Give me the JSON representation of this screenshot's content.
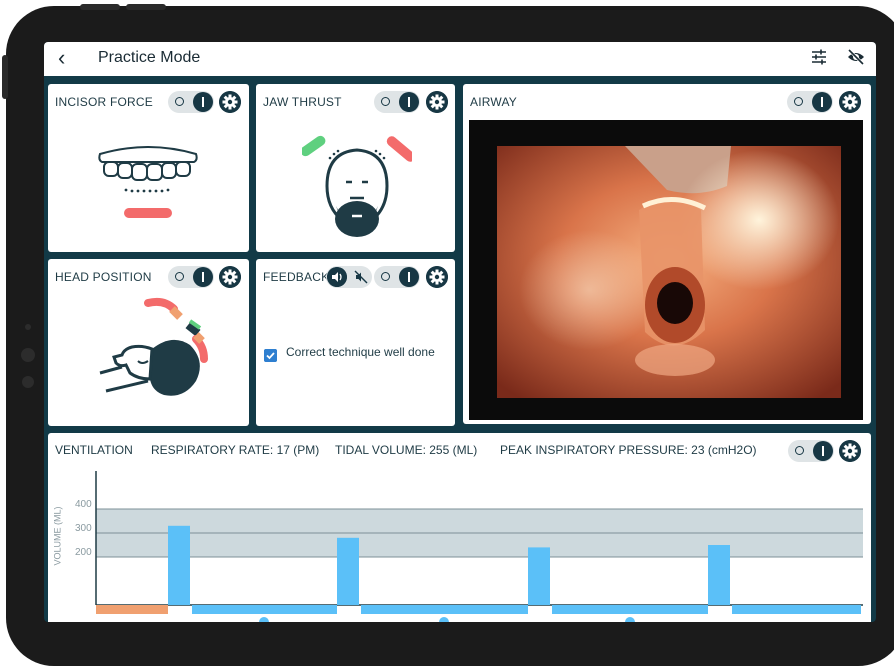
{
  "header": {
    "back_icon": "back-chevron-icon",
    "title": "Practice Mode",
    "tune_icon": "sliders-icon",
    "eye_icon": "eye-off-icon"
  },
  "panels": {
    "incisor_force": {
      "title": "INCISOR FORCE"
    },
    "jaw_thrust": {
      "title": "JAW THRUST"
    },
    "airway": {
      "title": "AIRWAY"
    },
    "head_position": {
      "title": "HEAD POSITION"
    },
    "feedback": {
      "title": "FEEDBACK",
      "message": "Correct technique well done",
      "checked": true
    }
  },
  "ventilation": {
    "title": "VENTILATION",
    "respiratory_rate": "RESPIRATORY RATE: 17 (PM)",
    "tidal_volume": "TIDAL VOLUME: 255 (ML)",
    "peak_pressure": "PEAK INSPIRATORY PRESSURE: 23 (cmH2O)"
  },
  "colors": {
    "accent": "#173744",
    "bar": "#5bc0f8",
    "red": "#f36b6b",
    "green": "#5fd07f",
    "orange": "#f0a070"
  },
  "chart_data": {
    "type": "bar",
    "ylabel": "VOLUME (ML)",
    "yticks": [
      200,
      300,
      400
    ],
    "ylim": [
      0,
      460
    ],
    "values": [
      330,
      280,
      240,
      250
    ]
  }
}
